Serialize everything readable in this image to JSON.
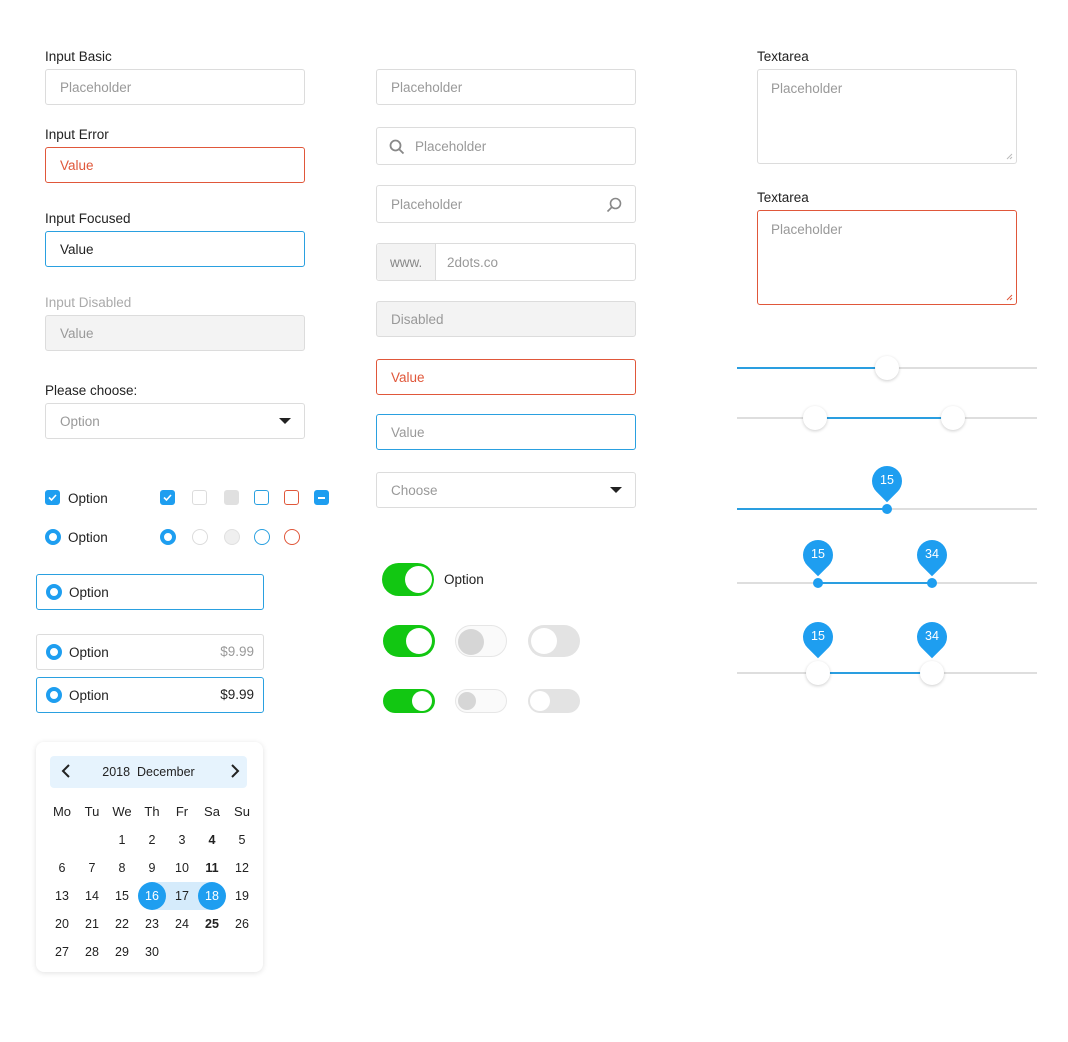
{
  "colors": {
    "accent": "#1e9ef0",
    "error": "#e0573a",
    "toggle_on": "#12c712",
    "border": "#dcdcdc"
  },
  "col1": {
    "input_basic": {
      "label": "Input Basic",
      "placeholder": "Placeholder"
    },
    "input_error": {
      "label": "Input Error",
      "value": "Value"
    },
    "input_focused": {
      "label": "Input Focused",
      "value": "Value"
    },
    "input_disabled": {
      "label": "Input Disabled",
      "value": "Value"
    },
    "select": {
      "label": "Please choose:",
      "value": "Option",
      "icon": "caret-down-icon"
    },
    "checkbox": {
      "label": "Option",
      "checked": true
    },
    "radio": {
      "label": "Option",
      "checked": true
    },
    "checkbox_states": [
      "checked",
      "unchecked",
      "disabled",
      "focused",
      "error",
      "indeterminate"
    ],
    "radio_states": [
      "checked",
      "unchecked",
      "disabled",
      "focused",
      "error"
    ],
    "radio_card": {
      "label": "Option"
    },
    "price_options": [
      {
        "label": "Option",
        "price": "$9.99",
        "state": "default"
      },
      {
        "label": "Option",
        "price": "$9.99",
        "state": "selected"
      }
    ]
  },
  "calendar": {
    "year": "2018",
    "month": "December",
    "title": "2018  December",
    "weekdays": [
      "Mo",
      "Tu",
      "We",
      "Th",
      "Fr",
      "Sa",
      "Su"
    ],
    "weeks": [
      [
        "",
        "",
        "1",
        "2",
        "3",
        "4",
        "5"
      ],
      [
        "6",
        "7",
        "8",
        "9",
        "10",
        "11",
        "12"
      ],
      [
        "13",
        "14",
        "15",
        "16",
        "17",
        "18",
        "19"
      ],
      [
        "20",
        "21",
        "22",
        "23",
        "24",
        "25",
        "26"
      ],
      [
        "27",
        "28",
        "29",
        "30",
        "",
        "",
        ""
      ]
    ],
    "range_start": "16",
    "range_end": "18",
    "bold_days": [
      "4",
      "11",
      "25"
    ]
  },
  "col2": {
    "input_plain": {
      "placeholder": "Placeholder"
    },
    "input_search_left": {
      "placeholder": "Placeholder",
      "icon": "search-icon"
    },
    "input_search_right": {
      "placeholder": "Placeholder",
      "icon": "search-icon"
    },
    "input_addon": {
      "prefix": "www.",
      "value": "2dots.co"
    },
    "input_disabled": {
      "value": "Disabled"
    },
    "input_error": {
      "value": "Value"
    },
    "input_focused": {
      "value": "Value"
    },
    "select": {
      "value": "Choose",
      "icon": "caret-down-icon"
    },
    "toggle_labeled": {
      "label": "Option",
      "on": true
    },
    "toggles_large": [
      "on",
      "off-disabled",
      "off"
    ],
    "toggles_small": [
      "on",
      "off-disabled",
      "off"
    ]
  },
  "col3": {
    "textarea": {
      "label": "Textarea",
      "placeholder": "Placeholder"
    },
    "textarea_error": {
      "label": "Textarea",
      "placeholder": "Placeholder"
    },
    "slider_single": {
      "value_fraction": 0.5
    },
    "slider_range": {
      "low_fraction": 0.26,
      "high_fraction": 0.72
    },
    "slider_tooltip": {
      "value": "15",
      "value_fraction": 0.5
    },
    "slider_range_tooltip": {
      "low": "15",
      "high": "34",
      "low_fraction": 0.27,
      "high_fraction": 0.65
    },
    "slider_range_tooltip_thumbs": {
      "low": "15",
      "high": "34",
      "low_fraction": 0.27,
      "high_fraction": 0.65
    }
  }
}
